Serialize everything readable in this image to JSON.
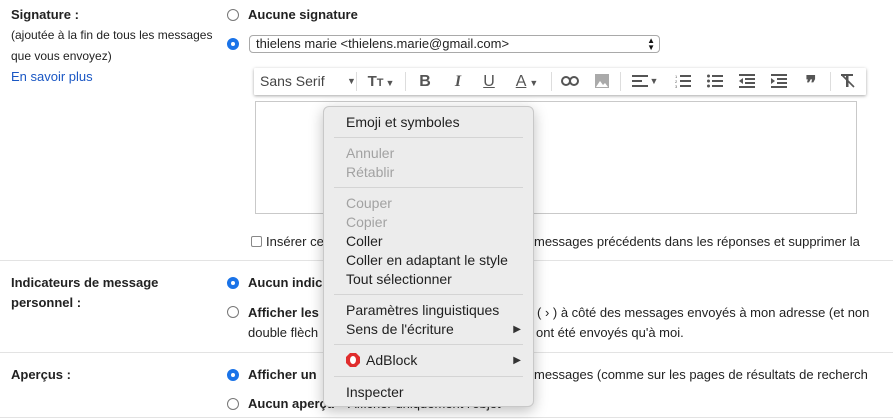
{
  "signature": {
    "label": "Signature :",
    "hint_line1": "(ajoutée à la fin de tous les messages",
    "hint_line2": "que vous envoyez)",
    "learn_more": "En savoir plus",
    "option_none": "Aucune signature",
    "selected_signature": "thielens marie <thielens.marie@gmail.com>",
    "insert_checkbox_text_left": "Insérer ce",
    "insert_checkbox_text_right": "messages précédents dans les réponses et supprimer la"
  },
  "toolbar": {
    "font_family": "Sans Serif",
    "icons": [
      "font-size-icon",
      "bold-icon",
      "italic-icon",
      "underline-icon",
      "text-color-icon",
      "link-icon",
      "image-icon",
      "align-icon",
      "numbered-list-icon",
      "bulleted-list-icon",
      "indent-less-icon",
      "indent-more-icon",
      "quote-icon",
      "remove-formatting-icon"
    ]
  },
  "personal_indicators": {
    "label_line1": "Indicateurs de message",
    "label_line2": "personnel :",
    "option1": "Aucun indic",
    "option2_bold": "Afficher les",
    "option2_rest": "( › ) à côté des messages envoyés à mon adresse (et non",
    "option2_line2_left": "double flèch",
    "option2_line2_right": "ont été envoyés qu'à moi."
  },
  "previews": {
    "label": "Aperçus :",
    "option1_bold": "Afficher un",
    "option1_rest": "messages (comme sur les pages de résultats de recherch",
    "option2_bold": "Aucun aperçu",
    "option2_rest": "Afficher uniquement l'objet"
  },
  "context_menu": {
    "emoji": "Emoji et symboles",
    "undo": "Annuler",
    "redo": "Rétablir",
    "cut": "Couper",
    "copy": "Copier",
    "paste": "Coller",
    "paste_match": "Coller en adaptant le style",
    "select_all": "Tout sélectionner",
    "language": "Paramètres linguistiques",
    "direction": "Sens de l'écriture",
    "adblock": "AdBlock",
    "inspect": "Inspecter"
  },
  "colors": {
    "accent": "#1a73e8",
    "link": "#1a57c4",
    "adblock": "#e02d2d"
  }
}
